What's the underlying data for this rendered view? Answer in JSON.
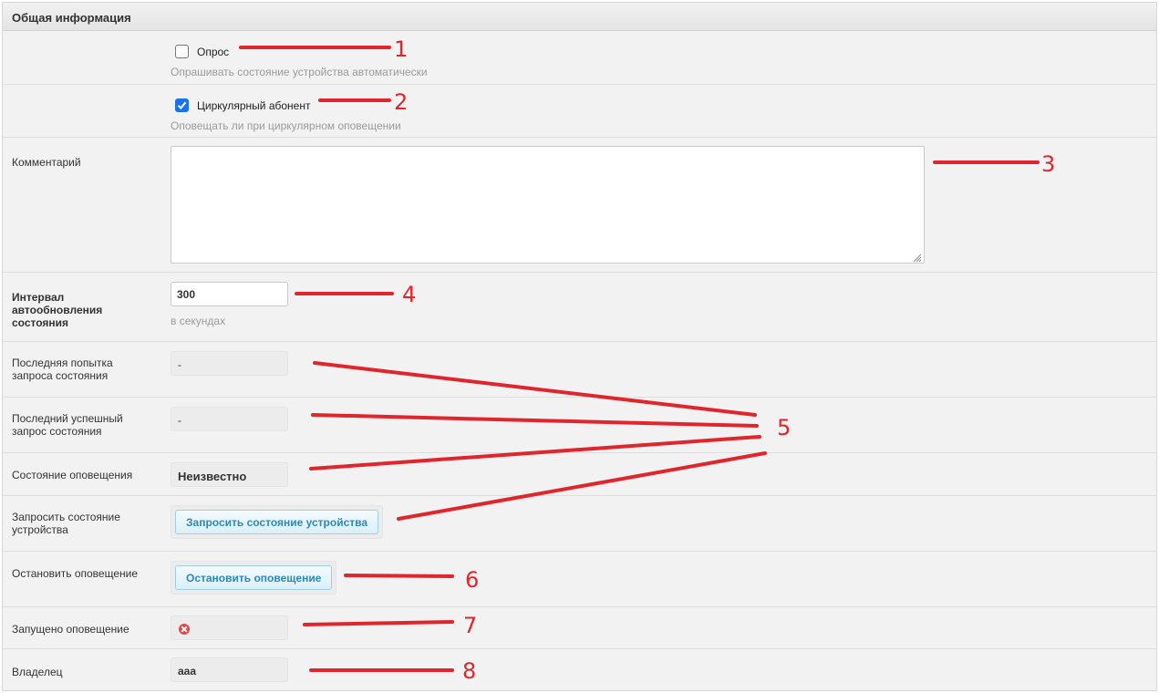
{
  "panel": {
    "title": "Общая информация"
  },
  "poll": {
    "label": "Опрос",
    "hint": "Опрашивать состояние устройства автоматически",
    "checked": false
  },
  "circular": {
    "label": "Циркулярный абонент",
    "hint": "Оповещать ли при циркулярном оповещении",
    "checked": true
  },
  "comment": {
    "label": "Комментарий",
    "value": ""
  },
  "interval": {
    "label": "Интервал автообновления состояния",
    "value": "300",
    "hint": "в секундах"
  },
  "last_attempt": {
    "label": "Последняя попытка запроса состояния",
    "value": "-"
  },
  "last_success": {
    "label": "Последний успешный запрос состояния",
    "value": "-"
  },
  "notify_state": {
    "label": "Состояние оповещения",
    "value": "Неизвестно"
  },
  "request_state": {
    "label": "Запросить состояние устройства",
    "button": "Запросить состояние устройства"
  },
  "stop_notify": {
    "label": "Остановить оповещение",
    "button": "Остановить оповещение"
  },
  "notify_started": {
    "label": "Запущено оповещение",
    "status_icon": "error-circle-icon"
  },
  "owner": {
    "label": "Владелец",
    "value": "aaa"
  },
  "annotations": {
    "color": "#e0262c",
    "numbers": [
      "1",
      "2",
      "3",
      "4",
      "5",
      "6",
      "7",
      "8"
    ]
  }
}
